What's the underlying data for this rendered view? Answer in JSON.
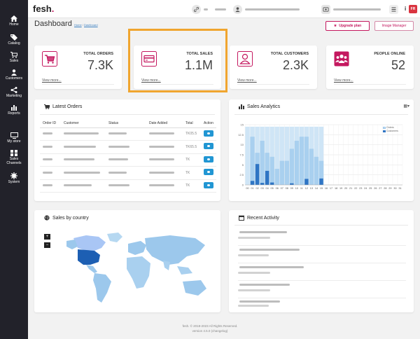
{
  "app": {
    "logo": "fesh",
    "logo_dot": "."
  },
  "topbar": {
    "link_icon": "link-icon",
    "user_icon": "user-icon",
    "store_icon": "store-icon",
    "menu_icon": "menu-icon",
    "info_label": "i",
    "language": "FR"
  },
  "sidebar": {
    "items": [
      {
        "label": "Home",
        "icon": "home-icon"
      },
      {
        "label": "Catalog",
        "icon": "tag-icon"
      },
      {
        "label": "Sales",
        "icon": "cart-icon"
      },
      {
        "label": "Customers",
        "icon": "person-icon"
      },
      {
        "label": "Marketing",
        "icon": "share-icon"
      },
      {
        "label": "Reports",
        "icon": "bar-chart-icon"
      },
      {
        "label": "My store",
        "icon": "monitor-icon"
      },
      {
        "label": "Sales Channels",
        "icon": "channels-icon"
      },
      {
        "label": "System",
        "icon": "gear-icon"
      }
    ]
  },
  "header": {
    "title": "Dashboard",
    "breadcrumb": [
      "Home",
      "Dashboard"
    ],
    "upgrade_label": "Upgrade plan",
    "image_manager_label": "Image Manager"
  },
  "stats": [
    {
      "label": "TOTAL ORDERS",
      "value": "7.3K",
      "link": "View more...",
      "icon": "cart-icon"
    },
    {
      "label": "TOTAL SALES",
      "value": "1.1M",
      "link": "View more...",
      "icon": "credit-card-icon"
    },
    {
      "label": "TOTAL CUSTOMERS",
      "value": "2.3K",
      "link": "View more...",
      "icon": "person-icon"
    },
    {
      "label": "PEOPLE ONLINE",
      "value": "52",
      "link": "View more...",
      "icon": "users-icon"
    }
  ],
  "latest_orders": {
    "title": "Latest Orders",
    "columns": [
      "Order ID",
      "Customer",
      "Status",
      "Date Added",
      "Total",
      "Action"
    ],
    "rows": [
      {
        "total": "TK05.5"
      },
      {
        "total": "TK65.5"
      },
      {
        "total": "TK"
      },
      {
        "total": "TK"
      },
      {
        "total": "TK"
      }
    ]
  },
  "sales_analytics": {
    "title": "Sales Analytics",
    "legend": [
      "Orders",
      "Customers"
    ]
  },
  "chart_data": {
    "type": "bar",
    "categories": [
      "00",
      "01",
      "02",
      "03",
      "04",
      "05",
      "06",
      "07",
      "08",
      "09",
      "10",
      "11",
      "12",
      "13",
      "14",
      "15",
      "16",
      "17",
      "18",
      "19",
      "20",
      "21",
      "22",
      "23",
      "24",
      "25",
      "26",
      "27",
      "28",
      "29",
      "30",
      "31"
    ],
    "series": [
      {
        "name": "Orders",
        "values": [
          14.5,
          14.5,
          14.5,
          14.5,
          14.5,
          14.5,
          14.5,
          14.5,
          14.5,
          14.5,
          14.5,
          14.5,
          14.5,
          14.5,
          14.5,
          14.5,
          0,
          0,
          0,
          0,
          0,
          0,
          0,
          0,
          0,
          0,
          0,
          0,
          0,
          0,
          0,
          0
        ]
      },
      {
        "name": "Customers",
        "values": [
          0,
          1,
          5.2,
          0.5,
          3.5,
          0.6,
          0,
          0,
          0,
          0.4,
          0,
          0,
          1.5,
          0,
          0,
          1.6,
          0,
          0,
          0,
          0,
          0,
          0,
          0,
          0,
          0,
          0,
          0,
          0,
          0,
          0,
          0,
          0
        ]
      }
    ],
    "extra_orders_overlay": [
      0,
      12,
      8,
      11,
      8,
      7,
      4,
      6,
      6,
      9,
      11,
      12,
      12,
      9,
      7,
      6,
      0,
      0,
      0,
      0,
      0,
      0,
      0,
      0,
      0,
      0,
      0,
      0,
      0,
      0,
      0,
      0
    ],
    "yticks": [
      "0",
      "2.5",
      "5",
      "7.5",
      "10",
      "12.5",
      "15"
    ],
    "ylim": [
      0,
      15
    ],
    "grid": true,
    "legend_position": "top-right",
    "colors": {
      "orders": "#cfe5f6",
      "orders_dark": "#a9d0ef",
      "customers": "#2f75c4"
    }
  },
  "sales_by_country": {
    "title": "Sales by country",
    "zoom_in": "+",
    "zoom_out": "−"
  },
  "recent_activity": {
    "title": "Recent Activity"
  },
  "footer": {
    "line1": "fesh. © 2018-2023 All Rights Reserved.",
    "line2": "version 4.5.0 (changelog)"
  },
  "colors": {
    "brand": "#c4185f",
    "sidebar": "#22222a",
    "highlight": "#f0a52f",
    "action": "#2196d3"
  }
}
